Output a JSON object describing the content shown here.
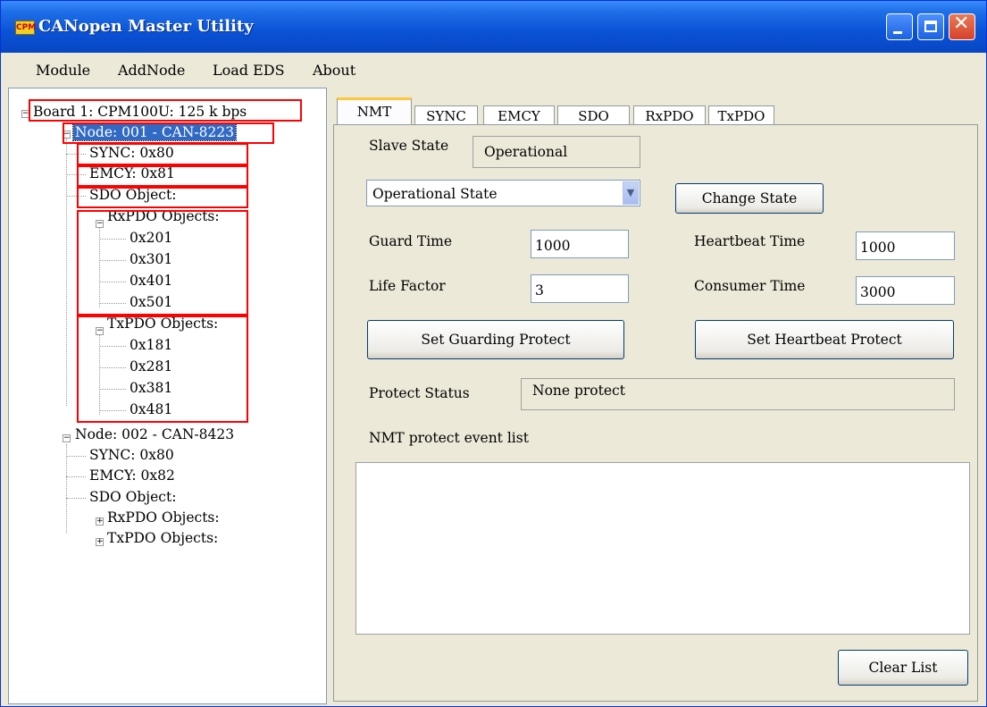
{
  "window": {
    "title": "CANopen Master Utility",
    "icon_label": "CPM"
  },
  "menu": [
    "Module",
    "AddNode",
    "Load EDS",
    "About"
  ],
  "tree": {
    "board": "Board 1: CPM100U:  125 k bps",
    "node1": {
      "label": "Node: 001 - CAN-8223",
      "sync": "SYNC: 0x80",
      "emcy": "EMCY: 0x81",
      "sdo": "SDO Object:",
      "rxpdo": "RxPDO Objects:",
      "rxpdo_items": [
        "0x201",
        "0x301",
        "0x401",
        "0x501"
      ],
      "txpdo": "TxPDO Objects:",
      "txpdo_items": [
        "0x181",
        "0x281",
        "0x381",
        "0x481"
      ]
    },
    "node2": {
      "label": "Node: 002 - CAN-8423",
      "sync": "SYNC: 0x80",
      "emcy": "EMCY: 0x82",
      "sdo": "SDO Object:",
      "rxpdo": "RxPDO Objects:",
      "txpdo": "TxPDO Objects:"
    }
  },
  "tabs": [
    "NMT",
    "SYNC",
    "EMCY",
    "SDO",
    "RxPDO",
    "TxPDO"
  ],
  "nmt": {
    "slave_state_label": "Slave State",
    "slave_state_value": "Operational",
    "state_select": "Operational State",
    "change_state": "Change State",
    "guard_time_label": "Guard Time",
    "guard_time_value": "1000",
    "life_factor_label": "Life Factor",
    "life_factor_value": "3",
    "heartbeat_label": "Heartbeat Time",
    "heartbeat_value": "1000",
    "consumer_label": "Consumer Time",
    "consumer_value": "3000",
    "set_guarding": "Set Guarding Protect",
    "set_heartbeat": "Set Heartbeat Protect",
    "protect_status_label": "Protect Status",
    "protect_status_value": "None protect",
    "event_list_label": "NMT protect event list",
    "clear_list": "Clear List"
  }
}
